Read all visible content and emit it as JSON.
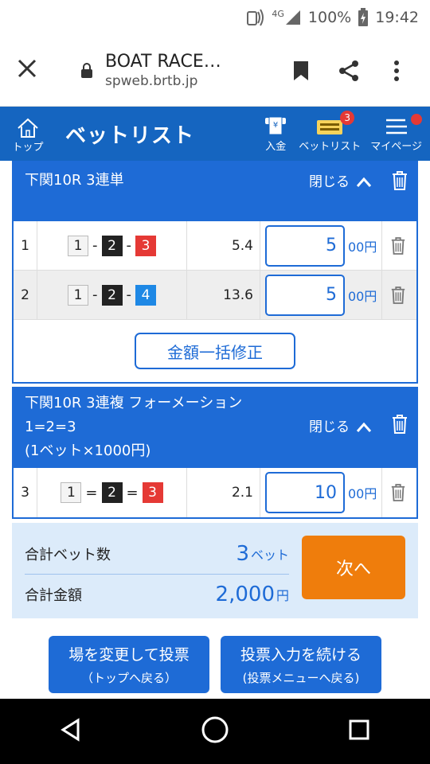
{
  "statusbar": {
    "network": "4G",
    "battery": "100%",
    "time": "19:42"
  },
  "browser": {
    "title": "BOAT RACE…",
    "url": "spweb.brtb.jp"
  },
  "header": {
    "home_label": "トップ",
    "title": "ベットリスト",
    "deposit_label": "入金",
    "betlist_label": "ベットリスト",
    "betlist_badge": "3",
    "mypage_label": "マイページ"
  },
  "groups": [
    {
      "title_lines": [
        "下関10R 3連単"
      ],
      "close_label": "閉じる",
      "rows": [
        {
          "no": "1",
          "combo": [
            "1",
            "2",
            "3"
          ],
          "sep": [
            "-",
            "-"
          ],
          "colors": [
            "b1",
            "b2",
            "b3"
          ],
          "odds": "5.4",
          "amount": "5",
          "unit": "00円"
        },
        {
          "no": "2",
          "combo": [
            "1",
            "2",
            "4"
          ],
          "sep": [
            "-",
            "-"
          ],
          "colors": [
            "b1",
            "b2",
            "b4"
          ],
          "odds": "13.6",
          "amount": "5",
          "unit": "00円"
        }
      ],
      "bulk_label": "金額一括修正"
    },
    {
      "title_lines": [
        "下関10R 3連複 フォーメーション",
        "1=2=3",
        "(1ベット×1000円)"
      ],
      "close_label": "閉じる",
      "rows": [
        {
          "no": "3",
          "combo": [
            "1",
            "2",
            "3"
          ],
          "sep": [
            "=",
            "="
          ],
          "colors": [
            "b1",
            "b2",
            "b3"
          ],
          "odds": "2.1",
          "amount": "10",
          "unit": "00円"
        }
      ]
    }
  ],
  "summary": {
    "bets_label": "合計ベット数",
    "bets_value": "3",
    "bets_unit": "ベット",
    "amount_label": "合計金額",
    "amount_value": "2,000",
    "amount_unit": "円",
    "next_label": "次へ"
  },
  "footer": {
    "change_main": "場を変更して投票",
    "change_sub": "（トップへ戻る）",
    "continue_main": "投票入力を続ける",
    "continue_sub": "(投票メニューへ戻る)"
  },
  "colors": {
    "primary": "#1e6bd6",
    "header": "#1565c0",
    "next": "#ef7d0c",
    "badge": "#e53935"
  }
}
